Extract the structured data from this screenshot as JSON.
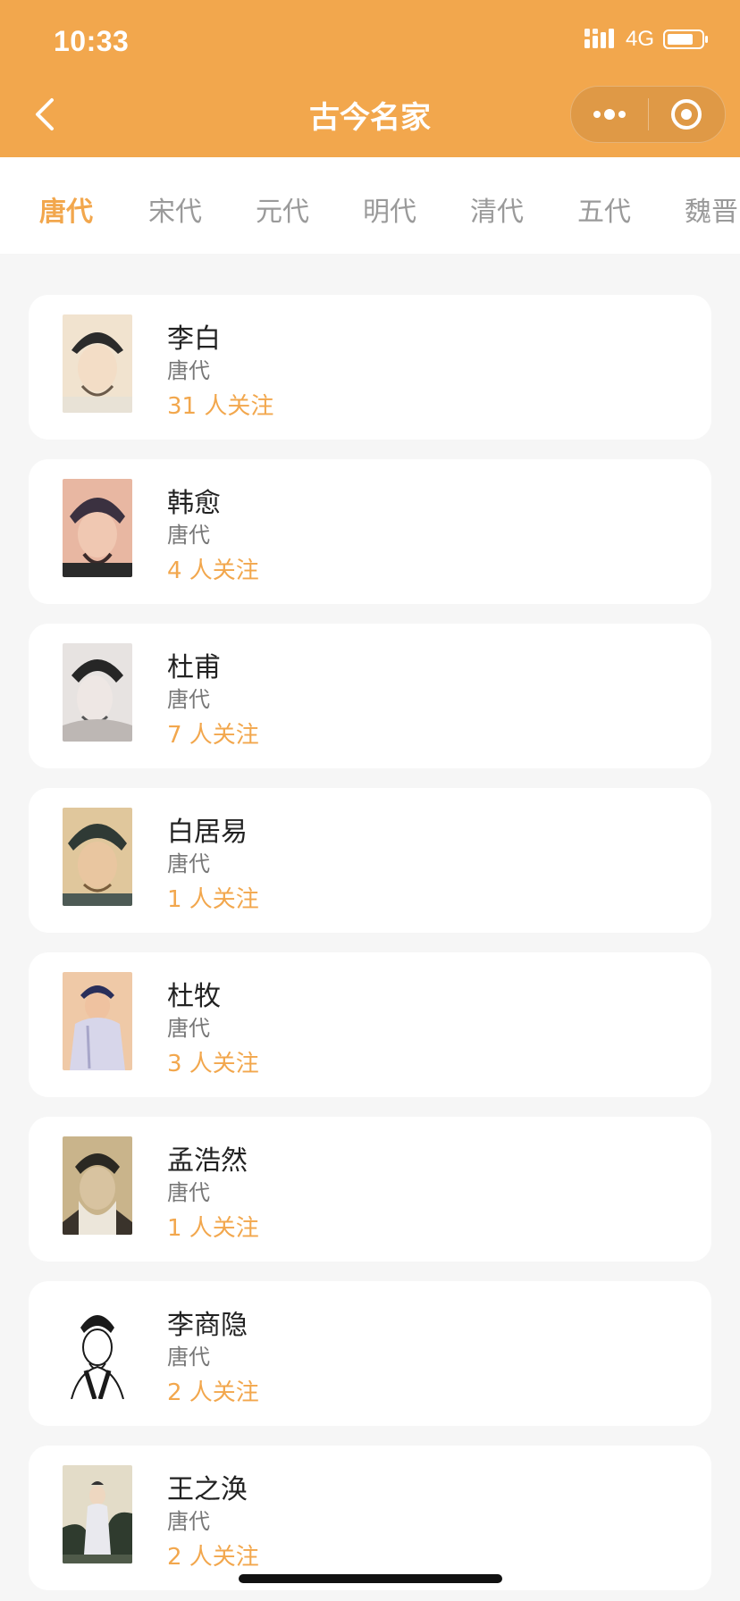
{
  "status": {
    "time": "10:33",
    "network": "4G"
  },
  "nav": {
    "title": "古今名家"
  },
  "tabs": [
    {
      "label": "唐代",
      "active": true
    },
    {
      "label": "宋代"
    },
    {
      "label": "元代"
    },
    {
      "label": "明代"
    },
    {
      "label": "清代"
    },
    {
      "label": "五代"
    },
    {
      "label": "魏晋"
    }
  ],
  "poets": [
    {
      "name": "李白",
      "dynasty": "唐代",
      "followers": "31 人关注",
      "colors": [
        "#f1e3cf",
        "#2b2b2b"
      ]
    },
    {
      "name": "韩愈",
      "dynasty": "唐代",
      "followers": "4 人关注",
      "colors": [
        "#e8b7a2",
        "#3b3140"
      ]
    },
    {
      "name": "杜甫",
      "dynasty": "唐代",
      "followers": "7 人关注",
      "colors": [
        "#e7e3e1",
        "#262626"
      ]
    },
    {
      "name": "白居易",
      "dynasty": "唐代",
      "followers": "1 人关注",
      "colors": [
        "#e0c79c",
        "#2f3a35"
      ]
    },
    {
      "name": "杜牧",
      "dynasty": "唐代",
      "followers": "3 人关注",
      "colors": [
        "#efc9a7",
        "#2a2f5a"
      ]
    },
    {
      "name": "孟浩然",
      "dynasty": "唐代",
      "followers": "1 人关注",
      "colors": [
        "#c9b48b",
        "#2a2822"
      ]
    },
    {
      "name": "李商隐",
      "dynasty": "唐代",
      "followers": "2 人关注",
      "colors": [
        "#ffffff",
        "#1a1a1a"
      ]
    },
    {
      "name": "王之涣",
      "dynasty": "唐代",
      "followers": "2 人关注",
      "colors": [
        "#e3dcc8",
        "#2f3b2e"
      ]
    }
  ],
  "colors": {
    "accent": "#f2a74d",
    "name": "#222222",
    "secondary": "#777777",
    "background": "#f6f6f6"
  }
}
